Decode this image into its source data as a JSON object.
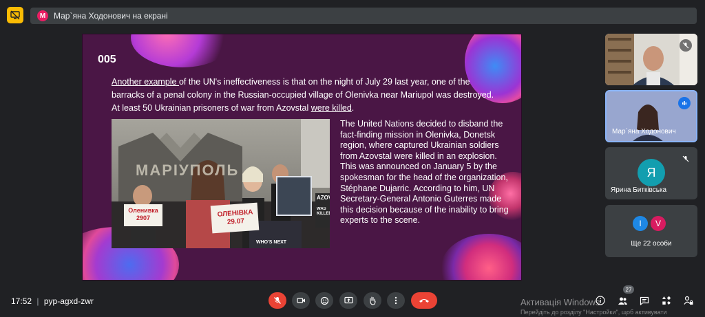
{
  "colors": {
    "background": "#202124",
    "panel": "#3c4043",
    "present_icon": "#fbbc04",
    "slide_bg": "#4a1645",
    "hangup": "#ea4335",
    "active_tile_border": "#8ab4f8",
    "speaking": "#1a73e8"
  },
  "presenter_banner": {
    "avatar_letter": "M",
    "avatar_color": "#e91e63",
    "text": "Мар`яна Ходонович на екрані"
  },
  "slide": {
    "number": "005",
    "paragraph": {
      "link1": "Another example ",
      "part1": "of the UN's ineffectiveness is that on the night of July 29 last year, one of the barracks of a penal colony in the Russian-occupied village of Olenivka near Mariupol was destroyed. At least 50 Ukrainian prisoners of war from Azovstal ",
      "link2": "were killed",
      "part2": "."
    },
    "photo": {
      "wall_sign": "МАРІУПОЛЬ",
      "sign_left": "Оленивка 2907",
      "sign_center": "ОЛЕНІВКА 29.07",
      "sign_right_top": "AZOV",
      "sign_right_mid": "WAS KILLED",
      "sign_right_bottom": "WHO'S NEXT"
    },
    "side_text": "The United Nations decided to disband the fact-finding mission in Olenivka, Donetsk region, where captured Ukrainian soldiers from Azovstal were killed in an explosion. This was announced on January 5 by the spokesman for the head of the organization, Stéphane Dujarric. According to him, UN Secretary-General Antonio Guterres made this decision because of the inability to bring experts to the scene."
  },
  "participants": {
    "tile2_name": "Мар`яна Ходонович",
    "tile3_letter": "Я",
    "tile3_name": "Ярина Битківська",
    "tile4_avatars": [
      {
        "letter": "I",
        "color": "#1e88e5"
      },
      {
        "letter": "V",
        "color": "#d81b60"
      }
    ],
    "tile4_label": "Ще 22 особи"
  },
  "bottom": {
    "time": "17:52",
    "separator": "|",
    "meeting_code": "pyp-agxd-zwr",
    "people_count": "27"
  },
  "watermark": {
    "line1": "Активація Windows",
    "line2": "Перейдіть до розділу \"Настройки\", щоб активувати"
  },
  "icons": {
    "present": "present-icon",
    "mic_off": "mic-off-icon",
    "camera": "camera-icon",
    "emoji": "emoji-icon",
    "present_screen": "present-screen-icon",
    "raise_hand": "raise-hand-icon",
    "more": "more-vert-icon",
    "hangup": "call-end-icon",
    "info": "info-icon",
    "people": "people-icon",
    "chat": "chat-icon",
    "activities": "activities-icon",
    "host_controls": "lock-person-icon"
  }
}
